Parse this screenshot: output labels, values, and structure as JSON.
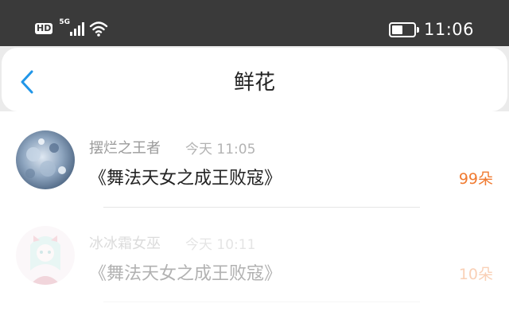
{
  "status_bar": {
    "hd_label": "HD",
    "network_label": "5G",
    "time": "11:06"
  },
  "nav": {
    "title": "鲜花",
    "back_icon": "chevron-left-icon",
    "accent": "#2196e8"
  },
  "items": [
    {
      "user": "摆烂之王者",
      "time": "今天 11:05",
      "book": "《舞法天女之成王败寇》",
      "count": "99朵"
    },
    {
      "user": "冰冰霜女巫",
      "time": "今天 10:11",
      "book": "《舞法天女之成王败寇》",
      "count": "10朵"
    }
  ],
  "colors": {
    "count": "#f07a30",
    "status_bar": "#3a3a3a"
  }
}
